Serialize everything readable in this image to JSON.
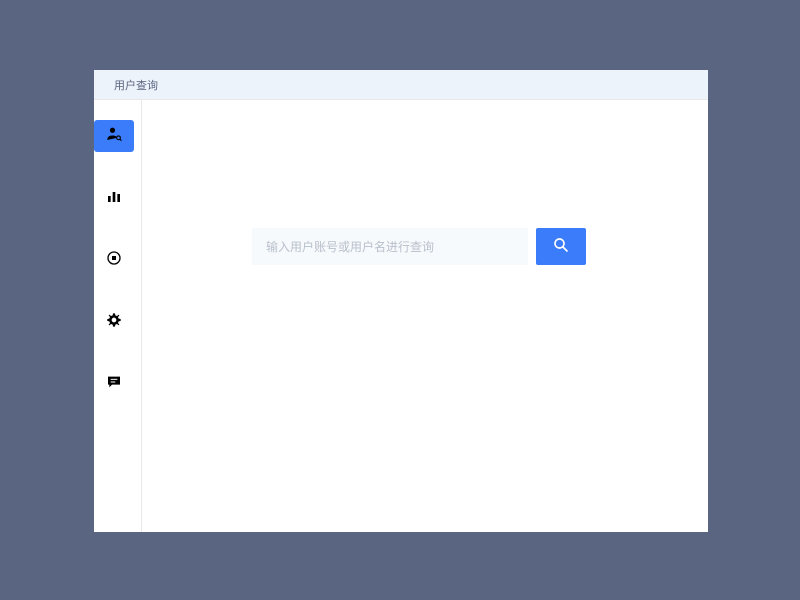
{
  "header": {
    "title": "用户查询"
  },
  "search": {
    "placeholder": "输入用户账号或用户名进行查询",
    "value": ""
  }
}
